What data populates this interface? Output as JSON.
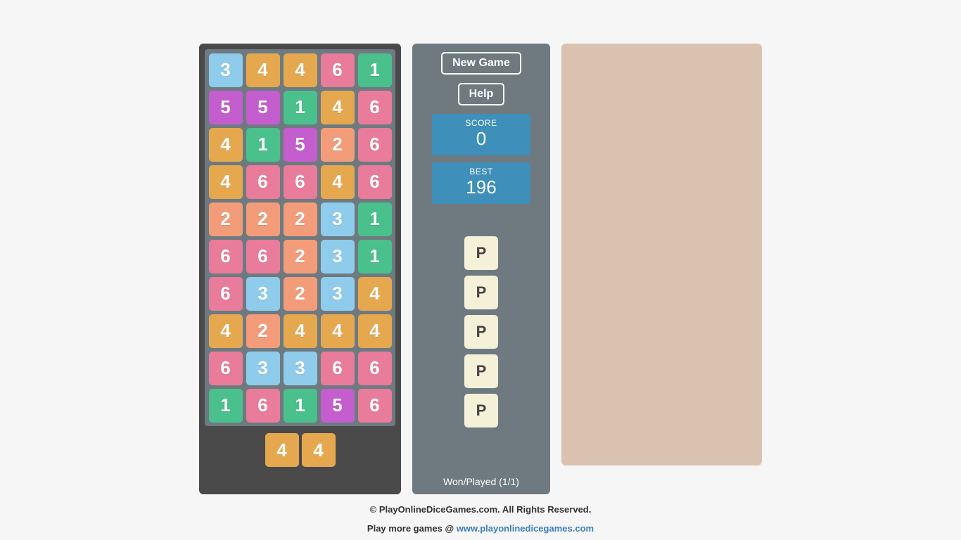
{
  "grid": [
    [
      3,
      4,
      4,
      6,
      1
    ],
    [
      5,
      5,
      1,
      4,
      6
    ],
    [
      4,
      1,
      5,
      2,
      6
    ],
    [
      4,
      6,
      6,
      4,
      6
    ],
    [
      2,
      2,
      2,
      3,
      1
    ],
    [
      6,
      6,
      2,
      3,
      1
    ],
    [
      6,
      3,
      2,
      3,
      4
    ],
    [
      4,
      2,
      4,
      4,
      4
    ],
    [
      6,
      3,
      3,
      6,
      6
    ],
    [
      1,
      6,
      1,
      5,
      6
    ]
  ],
  "next_tiles": [
    4,
    4
  ],
  "buttons": {
    "new_game": "New Game",
    "help": "Help"
  },
  "score": {
    "label": "SCORE",
    "value": "0"
  },
  "best": {
    "label": "BEST",
    "value": "196"
  },
  "history": [
    "P",
    "P",
    "P",
    "P",
    "P"
  ],
  "won_played": "Won/Played (1/1)",
  "footer": {
    "copyright": "© PlayOnlineDiceGames.com. All Rights Reserved.",
    "more_games_prefix": "Play more games @ ",
    "more_games_link": "www.playonlinedicegames.com"
  }
}
